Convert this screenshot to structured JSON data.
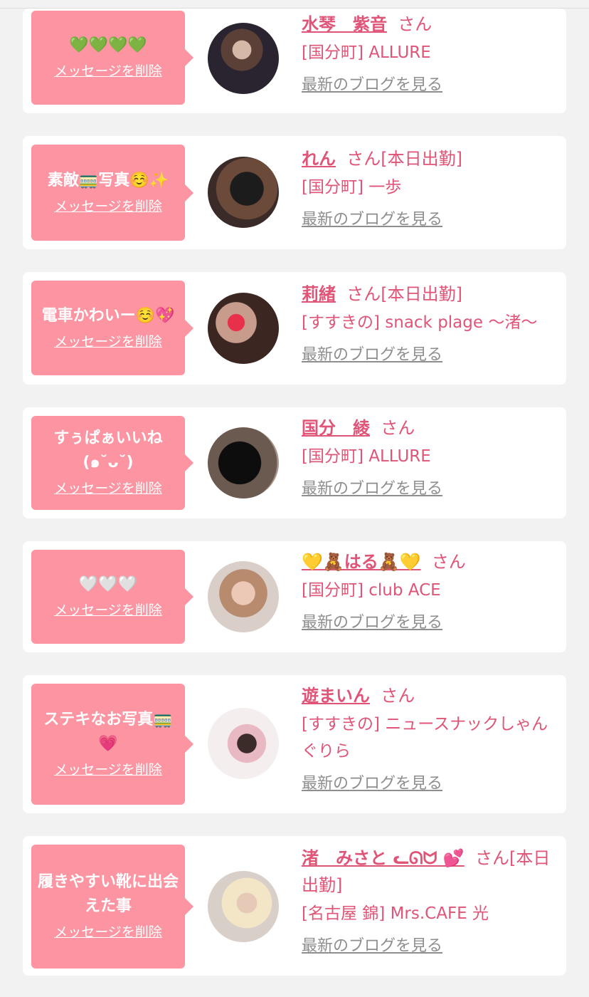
{
  "delete_label": "メッセージを削除",
  "blog_label": "最新のブログを見る",
  "colors": {
    "page_bg": "#f2f2f2",
    "bubble": "#fd94a2",
    "name": "#e05577",
    "link_gray": "#8e8e8e"
  },
  "entries": [
    {
      "message": "💚💚💚💚",
      "name": "水琴　紫音",
      "suffix": "さん",
      "shop": "[国分町] ALLURE"
    },
    {
      "message": "素敵🚃写真☺️✨",
      "name": "れん",
      "suffix": "さん[本日出勤]",
      "shop": "[国分町] 一歩"
    },
    {
      "message": "電車かわいー☺️💖",
      "name": "莉緒",
      "suffix": "さん[本日出勤]",
      "shop": "[すすきの] snack plage 〜渚〜"
    },
    {
      "message": "すぅぱぁいいね(๑˘ᴗ˘)",
      "name": "国分　綾",
      "suffix": "さん",
      "shop": "[国分町] ALLURE"
    },
    {
      "message": "🤍🤍🤍",
      "name": "💛🧸はる🧸💛",
      "suffix": "さん",
      "shop": "[国分町] club ACE"
    },
    {
      "message": "ステキなお写真🚃💗",
      "name": "遊まいん",
      "suffix": "さん",
      "shop": "[すすきの] ニュースナックしゃんぐりら"
    },
    {
      "message": "履きやすい靴に出会えた事",
      "name": "渚　みさと ᓚᘏᗢ 💕",
      "suffix": "さん[本日出勤]",
      "shop": "[名古屋 錦] Mrs.CAFE 光"
    }
  ]
}
